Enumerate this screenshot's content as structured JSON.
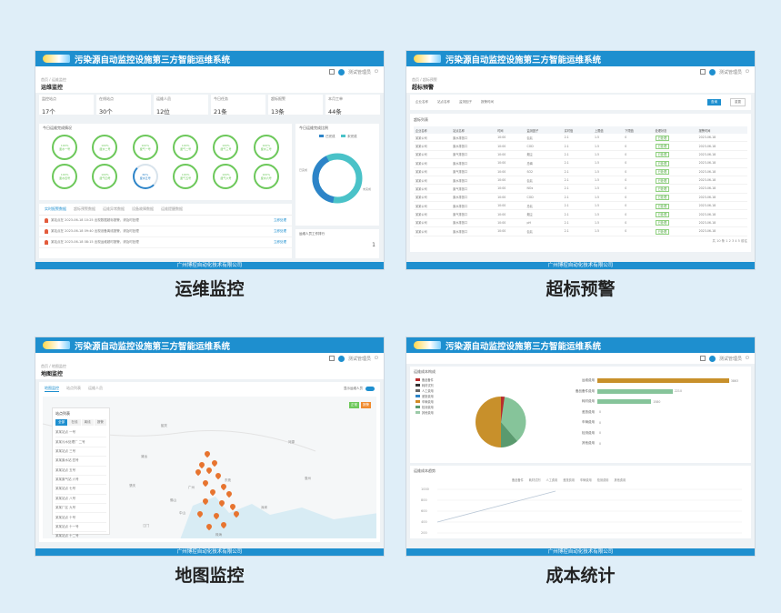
{
  "app": {
    "system_title": "污染源自动监控设施第三方智能运维系统",
    "footer": "广州博控自动化技术有限公司",
    "user_label": "测试管理员",
    "primary_color": "#1e8fcf",
    "background_color": "#dfeef8"
  },
  "panel1": {
    "caption": "运维监控",
    "crumbs": "首页 / 运维监控",
    "page_title": "运维监控",
    "stats": [
      {
        "label": "监控站点",
        "value": "17个"
      },
      {
        "label": "在线站点",
        "value": "30个"
      },
      {
        "label": "运维人员",
        "value": "12位"
      },
      {
        "label": "今日任务",
        "value": "21条"
      },
      {
        "label": "超标报警",
        "value": "13条"
      },
      {
        "label": "本月工单",
        "value": "44条"
      }
    ],
    "ring_card_title": "今日运维完成情况",
    "rings": [
      "100%\n废水一号",
      "100%\n废水二号",
      "100%\n废气一号",
      "100%\n废气二号",
      "100%\n废气三号",
      "100%\n废水三号",
      "100%\n废水四号",
      "100%\n废气四号",
      "60%\n废水五号",
      "100%\n废气五号",
      "100%\n废气六号",
      "100%\n废水六号"
    ],
    "donut_title": "今日运维完成比例",
    "donut_legend": [
      "已完成",
      "未完成"
    ],
    "donut_labels": [
      "已完成",
      "未完成"
    ],
    "alarm_tabs": [
      "实时报警数据",
      "超标预警数据",
      "运维异常数据",
      "设备故障数据",
      "运维提醒数据"
    ],
    "alarms": [
      {
        "text": "某站点在 2023-06-18 10:25 出现数据超标报警，请及时处理",
        "link": "立即处理"
      },
      {
        "text": "某站点在 2023-06-18 09:40 出现设备离线报警，请及时处理",
        "link": "立即处理"
      },
      {
        "text": "某站点在 2023-06-18 08:15 出现运维超时报警，请及时处理",
        "link": "立即处理"
      }
    ],
    "ops_title": "运维人员工作排行",
    "ops_rank": "1"
  },
  "panel2": {
    "caption": "超标预警",
    "crumbs": "首页 / 超标预警",
    "page_title": "超标预警",
    "filters": [
      "企业名称",
      "站点名称",
      "监测因子",
      "报警时间"
    ],
    "search_btn": "查询",
    "reset_btn": "重置",
    "table_title": "超标列表",
    "columns": [
      "企业名称",
      "站点名称",
      "时间",
      "监测因子",
      "实时值",
      "上限值",
      "下限值",
      "处理状态",
      "报警时间"
    ],
    "rows": [
      [
        "某某公司",
        "废水排放口",
        "10:00",
        "氨氮",
        "2.1",
        "1.5",
        "0",
        "已处理",
        "2023-06-18"
      ],
      [
        "某某公司",
        "废水排放口",
        "10:00",
        "COD",
        "2.1",
        "1.5",
        "0",
        "已处理",
        "2023-06-18"
      ],
      [
        "某某公司",
        "废气排放口",
        "10:00",
        "烟尘",
        "2.1",
        "1.5",
        "0",
        "已处理",
        "2023-06-18"
      ],
      [
        "某某公司",
        "废水排放口",
        "10:00",
        "总磷",
        "2.1",
        "1.5",
        "0",
        "已处理",
        "2023-06-18"
      ],
      [
        "某某公司",
        "废气排放口",
        "10:00",
        "SO2",
        "2.1",
        "1.5",
        "0",
        "已处理",
        "2023-06-18"
      ],
      [
        "某某公司",
        "废水排放口",
        "10:00",
        "氨氮",
        "2.1",
        "1.5",
        "0",
        "已处理",
        "2023-06-18"
      ],
      [
        "某某公司",
        "废气排放口",
        "10:00",
        "NOx",
        "2.1",
        "1.5",
        "0",
        "已处理",
        "2023-06-18"
      ],
      [
        "某某公司",
        "废水排放口",
        "10:00",
        "COD",
        "2.1",
        "1.5",
        "0",
        "已处理",
        "2023-06-18"
      ],
      [
        "某某公司",
        "废水排放口",
        "10:00",
        "总氮",
        "2.1",
        "1.5",
        "0",
        "已处理",
        "2023-06-18"
      ],
      [
        "某某公司",
        "废气排放口",
        "10:00",
        "烟尘",
        "2.1",
        "1.5",
        "0",
        "已处理",
        "2023-06-18"
      ],
      [
        "某某公司",
        "废水排放口",
        "10:00",
        "pH",
        "2.1",
        "1.5",
        "0",
        "已处理",
        "2023-06-18"
      ],
      [
        "某某公司",
        "废水排放口",
        "10:00",
        "氨氮",
        "2.1",
        "1.5",
        "0",
        "已处理",
        "2023-06-18"
      ]
    ],
    "pager": "共 10 条  1 2 3 4 5  前往"
  },
  "panel3": {
    "caption": "地图监控",
    "crumbs": "首页 / 地图监控",
    "page_title": "地图监控",
    "tabs": [
      "地图监控",
      "站点列表",
      "运维人员"
    ],
    "toggle_label": "显示运维人员",
    "list_title": "站点列表",
    "list_tabs": [
      "全部",
      "在线",
      "离线",
      "报警"
    ],
    "list_rows": [
      "某某站点 一号",
      "某某污水处理厂 二号",
      "某某站点 三号",
      "某某废水站 四号",
      "某某站点 五号",
      "某某废气站 六号",
      "某某站点 七号",
      "某某站点 八号",
      "某某厂区 九号",
      "某某站点 十号",
      "某某站点 十一号",
      "某某站点 十二号"
    ],
    "legend": [
      "正常",
      "报警"
    ],
    "cities": [
      "清远",
      "韶关",
      "河源",
      "广州",
      "东莞",
      "深圳",
      "佛山",
      "中山",
      "珠海",
      "江门",
      "惠州",
      "肇庆"
    ]
  },
  "panel4": {
    "caption": "成本统计",
    "pie_title": "运维成本构成",
    "pie_legend": [
      {
        "name": "备品备件",
        "color": "#b92c2c"
      },
      {
        "name": "耗材试剂",
        "color": "#333333"
      },
      {
        "name": "人工费用",
        "color": "#666666"
      },
      {
        "name": "差旅费用",
        "color": "#2d84c8"
      },
      {
        "name": "车辆费用",
        "color": "#d28a24"
      },
      {
        "name": "检测费用",
        "color": "#5a9a6e"
      },
      {
        "name": "其他费用",
        "color": "#9ccaa8"
      }
    ],
    "bars": [
      {
        "label": "运维费用",
        "value": 3863,
        "color": "#c8902b"
      },
      {
        "label": "备品备件费用",
        "value": 2210,
        "color": "#86c49a"
      },
      {
        "label": "耗材费用",
        "value": 1580,
        "color": "#86c49a"
      },
      {
        "label": "差旅费用",
        "value": 0,
        "color": "#86c49a"
      },
      {
        "label": "车辆费用",
        "value": 0,
        "color": "#86c49a"
      },
      {
        "label": "检测费用",
        "value": 0,
        "color": "#86c49a"
      },
      {
        "label": "其他费用",
        "value": 0,
        "color": "#86c49a"
      }
    ],
    "bar_max": 4000,
    "line_title": "运维成本趋势",
    "line_legend": [
      "备品备件",
      "耗材试剂",
      "人工费用",
      "差旅费用",
      "车辆费用",
      "检测费用",
      "其他费用"
    ],
    "y_ticks": [
      "1000",
      "800",
      "600",
      "400",
      "200"
    ]
  }
}
